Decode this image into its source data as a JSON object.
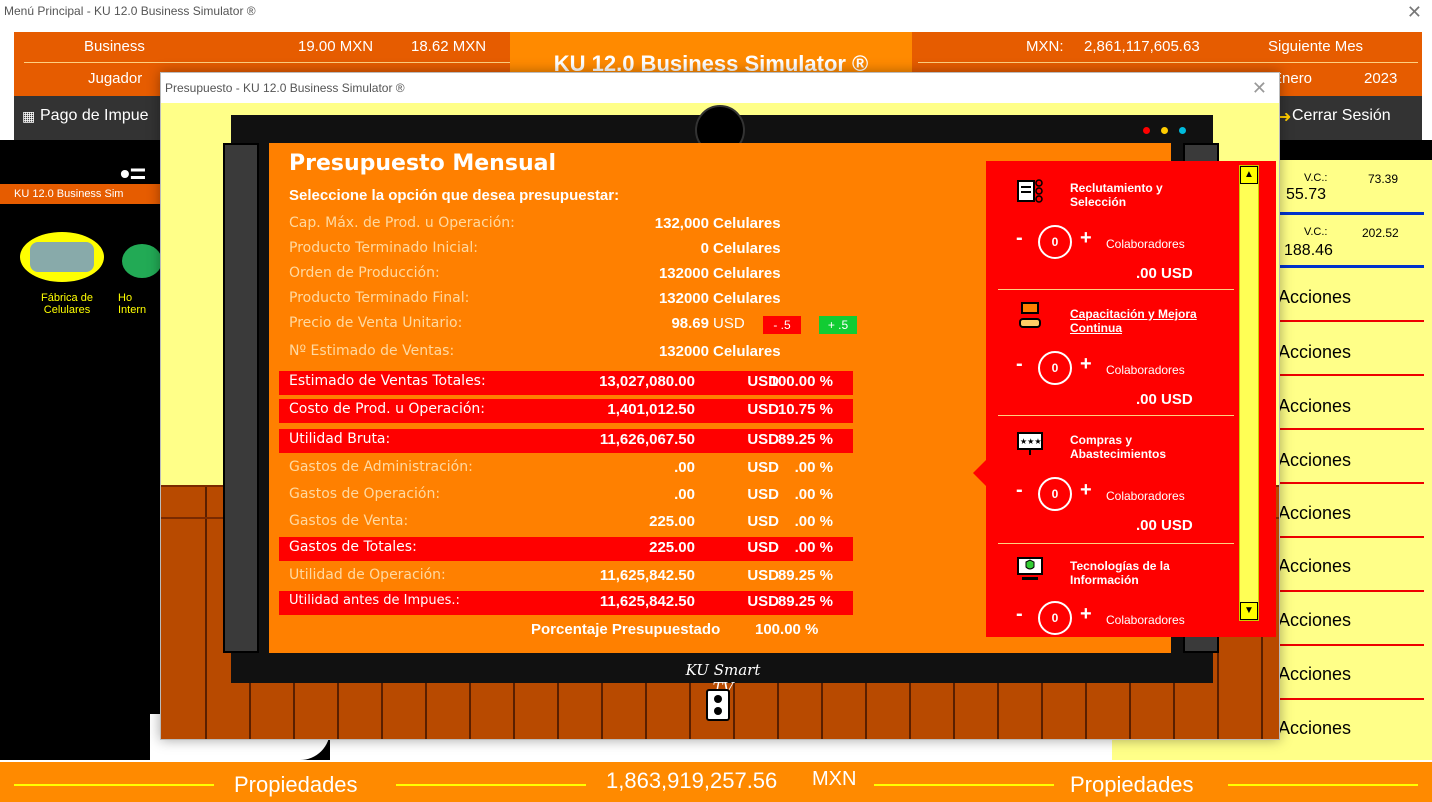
{
  "main_window": {
    "title": "Menú Principal - KU 12.0 Business Simulator ®",
    "close_glyph": "✕"
  },
  "header": {
    "business_label": "Business",
    "rate1": "19.00 MXN",
    "rate2": "18.62 MXN",
    "brand": "KU 12.0 Business Simulator ®",
    "mxn_label": "MXN:",
    "mxn_value": "2,861,117,605.63",
    "next_month": "Siguiente Mes",
    "player_label": "Jugador",
    "month": "Enero",
    "year": "2023"
  },
  "menubar": {
    "pago_impuestos": "Pago de Impue",
    "cerrar_sesion": "Cerrar Sesión"
  },
  "left_panel": {
    "subtitle": "KU 12.0 Business Sim",
    "item1": "Fábrica de Celulares",
    "item2_partial": "Ho Intern"
  },
  "right_panel": {
    "vc1_label": "V.C.:",
    "vc1_value": "73.39",
    "vc1_sub": "55.73",
    "vc2_label": "V.C.:",
    "vc2_value": "202.52",
    "vc2_sub": "188.46",
    "acciones": [
      "Acciones",
      "Acciones",
      "Acciones",
      "Acciones",
      "Acciones",
      "Acciones",
      "Acciones",
      "Acciones",
      "Acciones"
    ]
  },
  "footer": {
    "left": "Propiedades",
    "center_value": "1,863,919,257.56",
    "center_unit": "MXN",
    "right": "Propiedades"
  },
  "dialog": {
    "title": "Presupuesto - KU 12.0 Business Simulator ®",
    "close_glyph": "✕",
    "tv_brand": "KU Smart TV",
    "heading": "Presupuesto Mensual",
    "subheading": "Seleccione la opción que desea presupuestar:",
    "rows": [
      {
        "label": "Cap. Máx. de Prod. u Operación:",
        "value": "132,000",
        "unit": "Celulares"
      },
      {
        "label": "Producto Terminado Inicial:",
        "value": "0",
        "unit": "Celulares"
      },
      {
        "label": "Orden de Producción:",
        "value": "132000",
        "unit": "Celulares"
      },
      {
        "label": "Producto Terminado Final:",
        "value": "132000",
        "unit": "Celulares"
      },
      {
        "label": "Precio de Venta Unitario:",
        "value": "98.69",
        "unit": "USD",
        "minus": "- .5",
        "plus": "+ .5"
      },
      {
        "label": "Nº Estimado de Ventas:",
        "value": "132000",
        "unit": "Celulares"
      },
      {
        "label": "Estimado de Ventas Totales:",
        "value": "13,027,080.00",
        "unit": "USD",
        "pct": "100.00 %"
      },
      {
        "label": "Costo de Prod. u Operación:",
        "value": "1,401,012.50",
        "unit": "USD",
        "pct": "10.75 %"
      },
      {
        "label": "Utilidad Bruta:",
        "value": "11,626,067.50",
        "unit": "USD",
        "pct": "89.25 %"
      },
      {
        "label": "Gastos de Administración:",
        "value": ".00",
        "unit": "USD",
        "pct": ".00 %"
      },
      {
        "label": "Gastos de Operación:",
        "value": ".00",
        "unit": "USD",
        "pct": ".00 %"
      },
      {
        "label": "Gastos de Venta:",
        "value": "225.00",
        "unit": "USD",
        "pct": ".00 %"
      },
      {
        "label": "Gastos de Totales:",
        "value": "225.00",
        "unit": "USD",
        "pct": ".00 %"
      },
      {
        "label": "Utilidad de Operación:",
        "value": "11,625,842.50",
        "unit": "USD",
        "pct": "89.25 %"
      },
      {
        "label": "Utilidad antes de Impues.:",
        "value": "11,625,842.50",
        "unit": "USD",
        "pct": "89.25 %"
      }
    ],
    "total_label": "Porcentaje Presupuestado",
    "total_pct": "100.00 %",
    "sections": [
      {
        "title": "Reclutamiento y Selección",
        "count": "0",
        "colab": "Colaboradores",
        "usd": ".00  USD"
      },
      {
        "title": "Capacitación y Mejora Continua",
        "count": "0",
        "colab": "Colaboradores",
        "usd": ".00  USD"
      },
      {
        "title": "Compras y Abastecimientos",
        "count": "0",
        "colab": "Colaboradores",
        "usd": ".00  USD"
      },
      {
        "title": "Tecnologías de la Información",
        "count": "0",
        "colab": "Colaboradores"
      }
    ],
    "minus_glyph": "-",
    "plus_glyph": "+"
  },
  "colors": {
    "orange": "#ff8000",
    "dark_orange": "#e65c00",
    "red": "#ff0000",
    "yellow": "#ffff88",
    "floor": "#b84a00"
  }
}
